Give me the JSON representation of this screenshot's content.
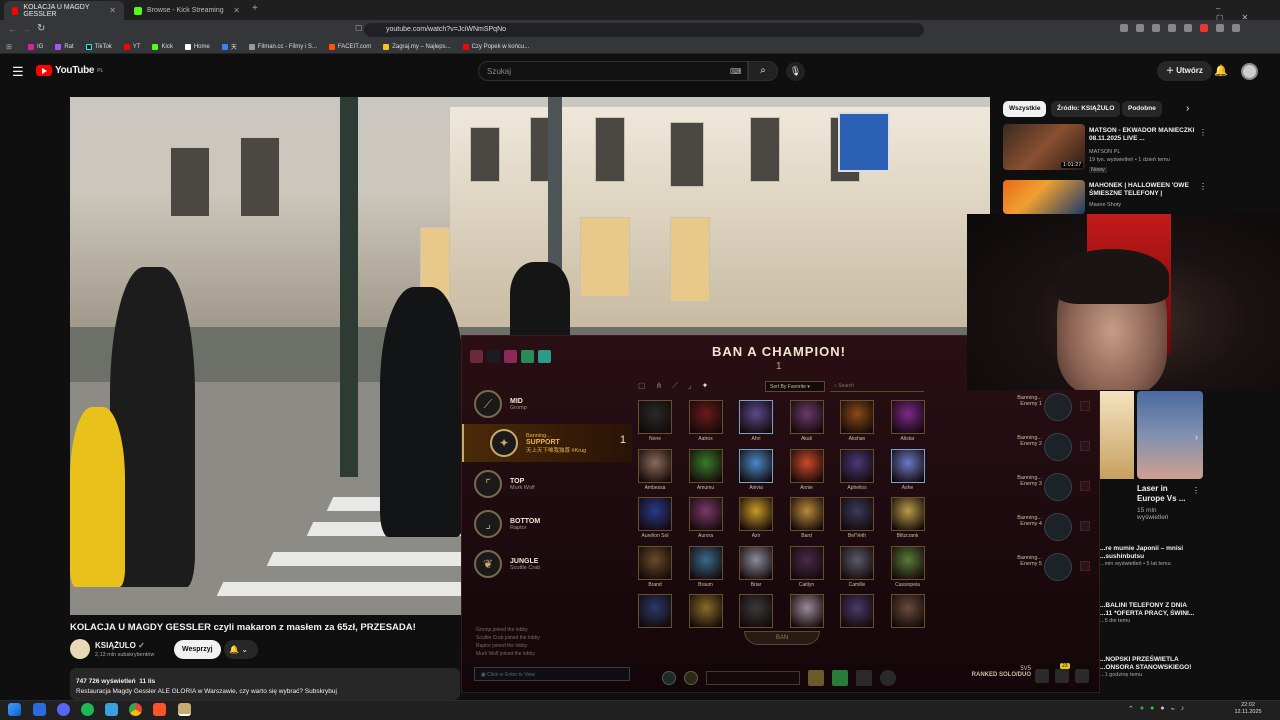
{
  "browser": {
    "tabs": [
      {
        "label": "KOLACJA U MAGDY GESSLER",
        "active": true
      },
      {
        "label": "Browse - Kick Streaming",
        "active": false
      }
    ],
    "new_tab": "+",
    "url": "youtube.com/watch?v=JciWNmSPqNo",
    "bookmarks": [
      "IG",
      "Rat",
      "TikTok",
      "YT",
      "Kick",
      "Home",
      "天",
      "Filman.cc - Filmy i S...",
      "FACEIT.com",
      "Zagraj.my – Najleps...",
      "Czy Popek w końcu..."
    ]
  },
  "youtube": {
    "logo": "YouTube",
    "region": "PL",
    "search_placeholder": "Szukaj",
    "create_label": "Utwórz",
    "video": {
      "title": "KOLACJA U MAGDY GESSLER czyli makaron z masłem za 65zł, PRZESADA!",
      "channel": "KSIĄŻULO",
      "subscribers": "2,13 mln subskrybentów",
      "support_btn": "Wesprzyj",
      "views": "747 726 wyświetleń",
      "date": "11 lis",
      "description": "Restauracja Magdy Gessler ALE GLORIA w Warszawie, czy warto się wybrać? Subskrybuj"
    },
    "chips": [
      "Wszystkie",
      "Źródło: KSIĄŻULO",
      "Podobne"
    ],
    "sidebar": [
      {
        "title": "MATSON - EKWADOR MANIECZKI 08.11.2025 LIVE ...",
        "channel": "MATSON PL",
        "meta": "19 tys. wyświetleń • 1 dzień temu",
        "badge": "Nowy",
        "duration": "1:01:27"
      },
      {
        "title": "MAHONEK | HALLOWEEN 'OWE ŚMIESZNE TELEFONY |",
        "channel": "Masne Shoty",
        "meta": "",
        "badge": "",
        "duration": ""
      }
    ],
    "sidebar_partial": [
      {
        "title": "Laser in Europe Vs ...",
        "meta": "15 mln wyświetleń"
      },
      {
        "title": "...re mumie Japonii – mnisi ...sushinbutsu",
        "meta": "...min wyświetleń • 5 lat temu"
      },
      {
        "title": "...BALINI TELEFONY Z DNIA ...11 *OFERTA PRACY, ŚWINI...",
        "meta": "...5 dni temu"
      },
      {
        "title": "...NOPSKI PRZEŚWIETLA ...ONSORA STANOWSKIEGO!",
        "meta": "...1 godzinę temu"
      }
    ]
  },
  "lol": {
    "title": "BAN A CHAMPION!",
    "ban_count": "1",
    "sort_label": "Sort By Favorite",
    "search_placeholder": "Search",
    "roles": [
      {
        "role": "MID",
        "player": "Gromp",
        "active": false
      },
      {
        "role": "SUPPORT",
        "player": "天上天下唯我独尊 #Krug",
        "status": "Banning...",
        "active": true,
        "count": "1"
      },
      {
        "role": "TOP",
        "player": "Murk Wolf",
        "active": false
      },
      {
        "role": "BOTTOM",
        "player": "Raptor",
        "active": false
      },
      {
        "role": "JUNGLE",
        "player": "Scuttle Crab",
        "active": false
      }
    ],
    "champions": [
      "None",
      "Aatrox",
      "Ahri",
      "Akali",
      "Akshan",
      "Alistar",
      "Ambessa",
      "Amumu",
      "Anivia",
      "Annie",
      "Aphelios",
      "Ashe",
      "Aurelion Sol",
      "Aurora",
      "Azir",
      "Bard",
      "Bel'Veth",
      "Blitzcrank",
      "Brand",
      "Braum",
      "Briar",
      "Caitlyn",
      "Camille",
      "Cassiopeia",
      "",
      "",
      "",
      "",
      "",
      ""
    ],
    "enemies": [
      {
        "status": "Banning...",
        "name": "Enemy 1"
      },
      {
        "status": "Banning...",
        "name": "Enemy 2"
      },
      {
        "status": "Banning...",
        "name": "Enemy 3"
      },
      {
        "status": "Banning...",
        "name": "Enemy 4"
      },
      {
        "status": "Banning...",
        "name": "Enemy 5"
      }
    ],
    "ban_button": "BAN",
    "chat": [
      "Gromp joined the lobby",
      "Scuttle Crab joined the lobby",
      "Raptor joined the lobby",
      "Murk Wolf joined the lobby"
    ],
    "chat_placeholder": "Click or Enter to View",
    "mode": "RANKED SOLO/DUO",
    "mode_sub": "5V5",
    "notif_count": "23"
  },
  "taskbar": {
    "time": "22:02",
    "date": "12.11.2025"
  },
  "colors": {
    "yt_red": "#ff0000",
    "lol_gold": "#c8aa6e",
    "lol_bg": "#1b0a0e"
  }
}
